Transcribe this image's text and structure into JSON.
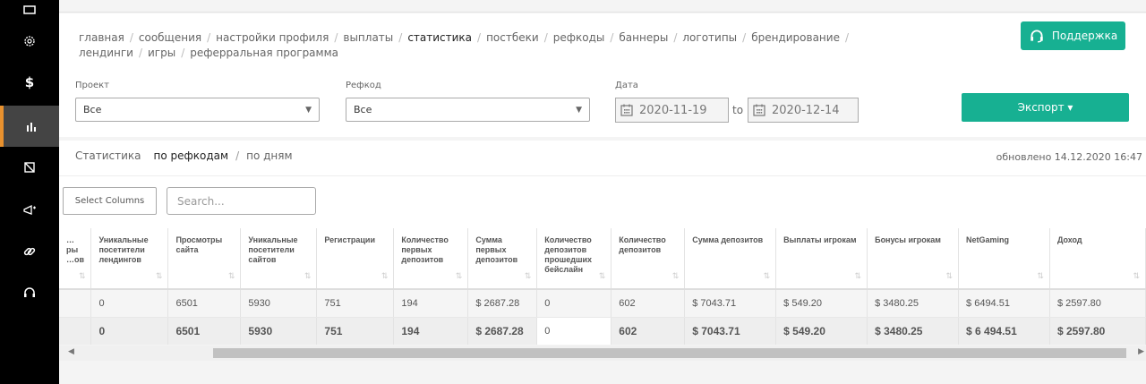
{
  "sidebar": {
    "items": [
      {
        "icon": "gear-icon",
        "active": false
      },
      {
        "icon": "dollar-icon",
        "active": false
      },
      {
        "icon": "bar-chart-icon",
        "active": true
      },
      {
        "icon": "banner-icon",
        "active": false
      },
      {
        "icon": "megaphone-icon",
        "active": false
      },
      {
        "icon": "link-icon",
        "active": false
      },
      {
        "icon": "headset-icon",
        "active": false
      }
    ],
    "dollar_glyph": "$",
    "active_color": "#e8912e"
  },
  "breadcrumbs": [
    {
      "label": "главная"
    },
    {
      "label": "сообщения"
    },
    {
      "label": "настройки профиля"
    },
    {
      "label": "выплаты"
    },
    {
      "label": "статистика",
      "current": true
    },
    {
      "label": "постбеки"
    },
    {
      "label": "рефкоды"
    },
    {
      "label": "баннеры"
    },
    {
      "label": "логотипы"
    },
    {
      "label": "брендирование"
    },
    {
      "label": "лендинги"
    },
    {
      "label": "игры"
    },
    {
      "label": "реферральная программа"
    }
  ],
  "support_button": {
    "label": "Поддержка",
    "icon": "headset-icon"
  },
  "filters": {
    "project_label": "Проект",
    "project_value": "Все",
    "refcode_label": "Рефкод",
    "refcode_value": "Все",
    "date_label": "Дата",
    "date_from": "2020-11-19",
    "date_to_label": "to",
    "date_to": "2020-12-14"
  },
  "export_button": {
    "label": "Экспорт ▾"
  },
  "stats_tabs": {
    "title": "Статистика",
    "by_refcodes": "по рефкодам",
    "separator": "/",
    "by_days": "по дням"
  },
  "updated": "обновлено 14.12.2020 16:47",
  "tools": {
    "select_columns": "Select Columns",
    "search_placeholder": "Search..."
  },
  "table": {
    "columns": [
      "…ры …ов",
      "Уникальные посетители лендингов",
      "Просмотры сайта",
      "Уникальные посетители сайтов",
      "Регистрации",
      "Количество первых депозитов",
      "Сумма первых депозитов",
      "Количество депозитов прошедших бейслайн",
      "Количество депозитов",
      "Сумма депозитов",
      "Выплаты игрокам",
      "Бонусы игрокам",
      "NetGaming",
      "Доход"
    ],
    "rows": [
      [
        "",
        "0",
        "6501",
        "5930",
        "751",
        "194",
        "$ 2687.28",
        "0",
        "602",
        "$ 7043.71",
        "$ 549.20",
        "$ 3480.25",
        "$ 6494.51",
        "$ 2597.80"
      ]
    ],
    "totals": [
      "",
      "0",
      "6501",
      "5930",
      "751",
      "194",
      "$ 2687.28",
      "0",
      "602",
      "$ 7043.71",
      "$ 549.20",
      "$ 3480.25",
      "$ 6 494.51",
      "$ 2597.80"
    ],
    "sort_glyph": "⇅"
  },
  "colors": {
    "accent": "#17b092",
    "sidebar_bg": "#000000",
    "active_marker": "#e8912e"
  }
}
